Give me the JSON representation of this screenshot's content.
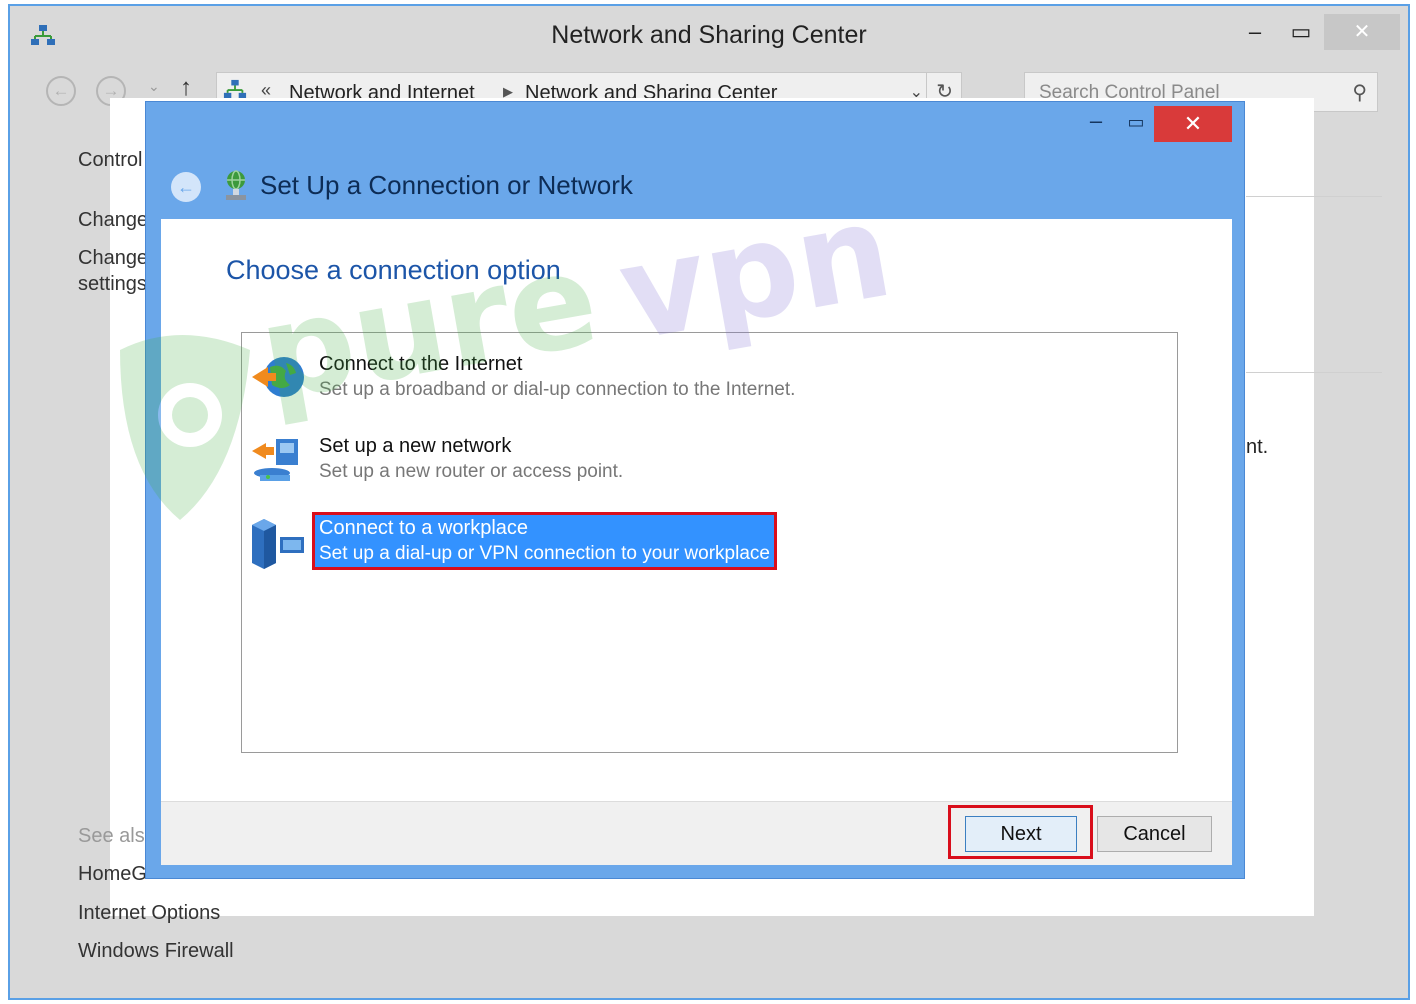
{
  "window": {
    "title": "Network and Sharing Center",
    "minimize": "‒",
    "maximize": "▭",
    "close": "✕"
  },
  "navigation": {
    "back_icon": "back-arrow-icon",
    "forward_icon": "forward-arrow-icon",
    "up_icon": "up-arrow-icon",
    "breadcrumbs": [
      "Network and Internet",
      "Network and Sharing Center"
    ],
    "search_placeholder": "Search Control Panel"
  },
  "sidebar": {
    "items": [
      "Control",
      "Change",
      "Change",
      "settings"
    ],
    "see_also": "See also",
    "see_also_links": [
      "HomeG",
      "Internet Options",
      "Windows Firewall"
    ]
  },
  "right_fragment": "nt.",
  "dialog": {
    "title": "Set Up a Connection or Network",
    "minimize": "‒",
    "maximize": "▭",
    "close": "✕",
    "instruction": "Choose a connection option",
    "options": [
      {
        "title": "Connect to the Internet",
        "description": "Set up a broadband or dial-up connection to the Internet.",
        "icon": "globe-icon"
      },
      {
        "title": "Set up a new network",
        "description": "Set up a new router or access point.",
        "icon": "router-icon"
      },
      {
        "title": "Connect to a workplace",
        "description": "Set up a dial-up or VPN connection to your workplace",
        "icon": "workplace-icon"
      }
    ],
    "selected_option": "Connect to a workplace",
    "buttons": {
      "next": "Next",
      "cancel": "Cancel"
    }
  },
  "watermark": "purevpn",
  "colors": {
    "accent": "#6aa7ea",
    "close_red": "#d93a3a",
    "selection": "#3392ff",
    "highlight": "#d90e1b",
    "heading_blue": "#1c55a8"
  }
}
